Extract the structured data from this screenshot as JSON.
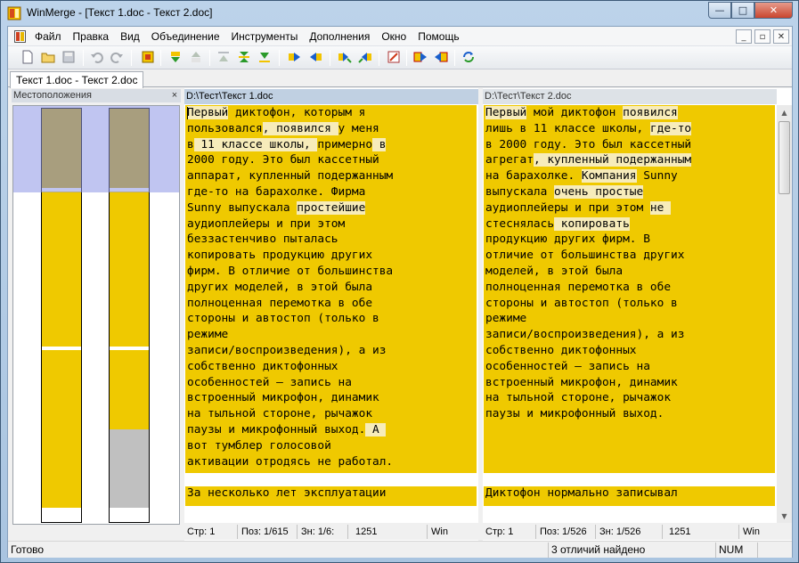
{
  "window": {
    "title": "WinMerge - [Текст 1.doc - Текст 2.doc]",
    "minimize": "—",
    "maximize": "□",
    "close": "✕"
  },
  "menu": {
    "items": [
      "Файл",
      "Правка",
      "Вид",
      "Объединение",
      "Инструменты",
      "Дополнения",
      "Окно",
      "Помощь"
    ],
    "mdi_minimize": "_",
    "mdi_restore": "▫",
    "mdi_close": "✕"
  },
  "tab": {
    "label": "Текст 1.doc - Текст 2.doc"
  },
  "location_pane": {
    "title": "Местоположения",
    "close": "×"
  },
  "left_pane": {
    "path": "D:\\Тест\\Текст 1.doc",
    "lines": [
      [
        [
          "Первый",
          "h"
        ],
        [
          " диктофон, которым я",
          ""
        ]
      ],
      [
        [
          "пользовался",
          ""
        ],
        [
          ", появился ",
          "h"
        ],
        [
          "у меня",
          ""
        ]
      ],
      [
        [
          "в",
          ""
        ],
        [
          " 11 классе школы, ",
          "h"
        ],
        [
          "примерно",
          ""
        ],
        [
          " в",
          "h"
        ]
      ],
      [
        [
          "2000 году. Это был кассетный",
          ""
        ]
      ],
      [
        [
          "аппарат, ",
          ""
        ],
        [
          "купленный подержанным",
          ""
        ]
      ],
      [
        [
          "где-то на барахолке. ",
          ""
        ],
        [
          "Фирма",
          ""
        ]
      ],
      [
        [
          "Sunny выпускала ",
          ""
        ],
        [
          "простейшие",
          "h"
        ]
      ],
      [
        [
          "аудиоплейеры и при этом",
          ""
        ]
      ],
      [
        [
          "беззастенчиво пыталась",
          ""
        ]
      ],
      [
        [
          "копировать продукцию других",
          ""
        ]
      ],
      [
        [
          "фирм. В отличие от большинства",
          ""
        ]
      ],
      [
        [
          "других моделей, в этой была",
          ""
        ]
      ],
      [
        [
          "полноценная перемотка в обе",
          ""
        ]
      ],
      [
        [
          "стороны и автостоп (только в",
          ""
        ]
      ],
      [
        [
          "режиме",
          ""
        ]
      ],
      [
        [
          "записи/воспроизведения), а из",
          ""
        ]
      ],
      [
        [
          "собственно диктофонных",
          ""
        ]
      ],
      [
        [
          "особенностей – запись на",
          ""
        ]
      ],
      [
        [
          "встроенный микрофон, динамик",
          ""
        ]
      ],
      [
        [
          "на тыльной стороне, рычажок",
          ""
        ]
      ],
      [
        [
          "паузы и микрофонный выход.",
          ""
        ],
        [
          " А ",
          "h"
        ]
      ],
      [
        [
          "вот тумблер голосовой",
          ""
        ]
      ],
      [
        [
          "активации отродясь не работал.",
          ""
        ]
      ],
      [
        [
          "",
          ""
        ]
      ],
      [
        [
          "За несколько лет эксплуатации",
          ""
        ]
      ]
    ],
    "status": {
      "line": "Стр: 1",
      "pos": "Поз: 1/615",
      "chars": "Зн: 1/6:",
      "codepage": "1251",
      "eol": "Win"
    }
  },
  "right_pane": {
    "path": "D:\\Тест\\Текст 2.doc",
    "lines": [
      [
        [
          "Первый",
          "h"
        ],
        [
          " мой диктофон ",
          ""
        ],
        [
          "появился",
          "h"
        ]
      ],
      [
        [
          "лишь в 11 классе школы, ",
          ""
        ],
        [
          "где-то",
          "h"
        ]
      ],
      [
        [
          "в 2000 году. Это был кассетный",
          ""
        ]
      ],
      [
        [
          "агрегат",
          ""
        ],
        [
          ", купленный подержанным",
          "h"
        ]
      ],
      [
        [
          "на барахолке. ",
          ""
        ],
        [
          "Компания",
          "h"
        ],
        [
          " Sunny",
          ""
        ]
      ],
      [
        [
          "выпускала ",
          ""
        ],
        [
          "очень простые",
          "h"
        ]
      ],
      [
        [
          "аудиоплейеры и при этом ",
          ""
        ],
        [
          "не ",
          "h"
        ]
      ],
      [
        [
          "стеснялась",
          ""
        ],
        [
          " копировать",
          "h"
        ]
      ],
      [
        [
          "продукцию других фирм. В",
          ""
        ]
      ],
      [
        [
          "отличие от большинства других",
          ""
        ]
      ],
      [
        [
          "моделей, в этой была",
          ""
        ]
      ],
      [
        [
          "полноценная перемотка в обе",
          ""
        ]
      ],
      [
        [
          "стороны и автостоп (только в",
          ""
        ]
      ],
      [
        [
          "режиме",
          ""
        ]
      ],
      [
        [
          "записи/воспроизведения), а из",
          ""
        ]
      ],
      [
        [
          "собственно диктофонных",
          ""
        ]
      ],
      [
        [
          "особенностей – запись на",
          ""
        ]
      ],
      [
        [
          "встроенный микрофон, динамик",
          ""
        ]
      ],
      [
        [
          "на тыльной стороне, рычажок",
          ""
        ]
      ],
      [
        [
          "паузы и микрофонный выход.",
          ""
        ]
      ],
      [
        [
          "",
          ""
        ]
      ],
      [
        [
          "",
          ""
        ]
      ],
      [
        [
          "",
          ""
        ]
      ],
      [
        [
          "",
          ""
        ]
      ],
      [
        [
          "Диктофон нормально записывал ",
          ""
        ]
      ]
    ],
    "status": {
      "line": "Стр: 1",
      "pos": "Поз: 1/526",
      "chars": "Зн: 1/526",
      "codepage": "1251",
      "eol": "Win"
    }
  },
  "statusbar": {
    "ready": "Готово",
    "differences": "3 отличий найдено",
    "num": "NUM"
  },
  "colors": {
    "diff": "#efc900",
    "word_diff": "#f7ecba",
    "location_view": "#8c96e6"
  }
}
